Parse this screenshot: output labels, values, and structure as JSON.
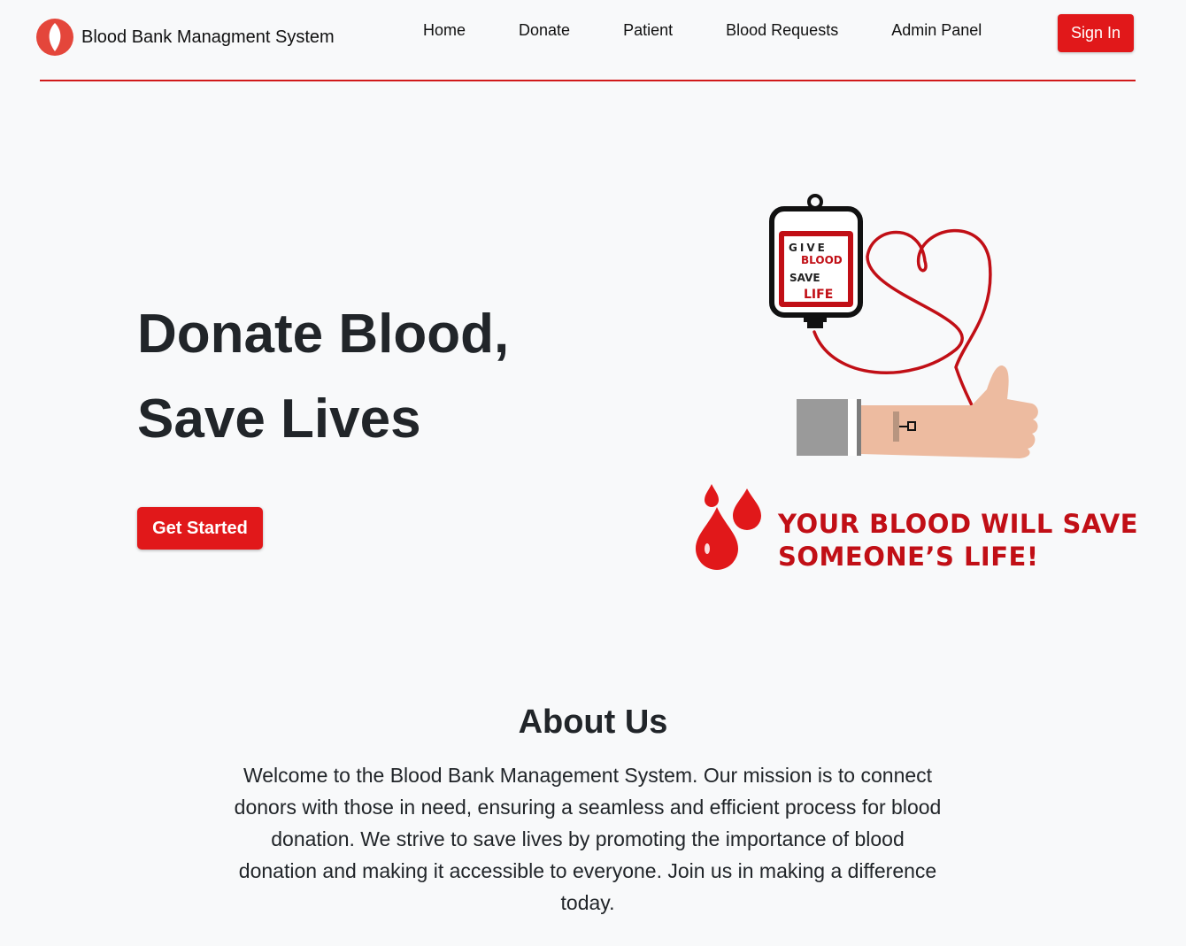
{
  "header": {
    "brand": "Blood Bank Managment System",
    "nav": [
      "Home",
      "Donate",
      "Patient",
      "Blood Requests",
      "Admin Panel"
    ],
    "signin_label": "Sign In"
  },
  "hero": {
    "title_line1": "Donate Blood,",
    "title_line2": "Save Lives",
    "cta_label": "Get Started",
    "bag_text": [
      "GIVE",
      "BLOOD",
      "SAVE",
      "LIFE"
    ],
    "tagline_line1": "YOUR BLOOD WILL SAVE",
    "tagline_line2": "SOMEONE’S LIFE!"
  },
  "about": {
    "title": "About Us",
    "text": "Welcome to the Blood Bank Management System. Our mission is to connect donors with those in need, ensuring a seamless and efficient process for blood donation. We strive to save lives by promoting the importance of blood donation and making it accessible to everyone. Join us in making a difference today."
  },
  "colors": {
    "accent": "#e1181a",
    "header_rule": "#d11a1a",
    "tagline": "#c10f16",
    "background": "#f8f9fa"
  },
  "icons": [
    "blood-drop-logo-icon",
    "blood-bag-illustration",
    "blood-drops-icon"
  ]
}
